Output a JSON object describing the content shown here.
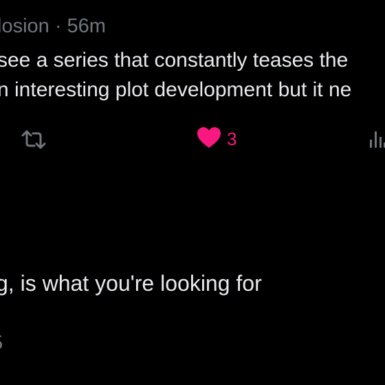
{
  "post": {
    "meta_fragment": "losion · 56m",
    "body_line_1": "see a series that constantly teases the",
    "body_line_2": "n interesting plot development but it ne",
    "actions": {
      "like_count": "3"
    }
  },
  "reply": {
    "body_fragment": "g, is what you're looking for",
    "meta_fragment": "5"
  },
  "colors": {
    "background": "#000000",
    "text_primary": "#e7e9ea",
    "text_secondary": "#71767b",
    "like_active": "#f91880"
  },
  "icons": {
    "retweet": "retweet-icon",
    "like": "heart-filled-icon",
    "views": "views-bar-icon"
  }
}
